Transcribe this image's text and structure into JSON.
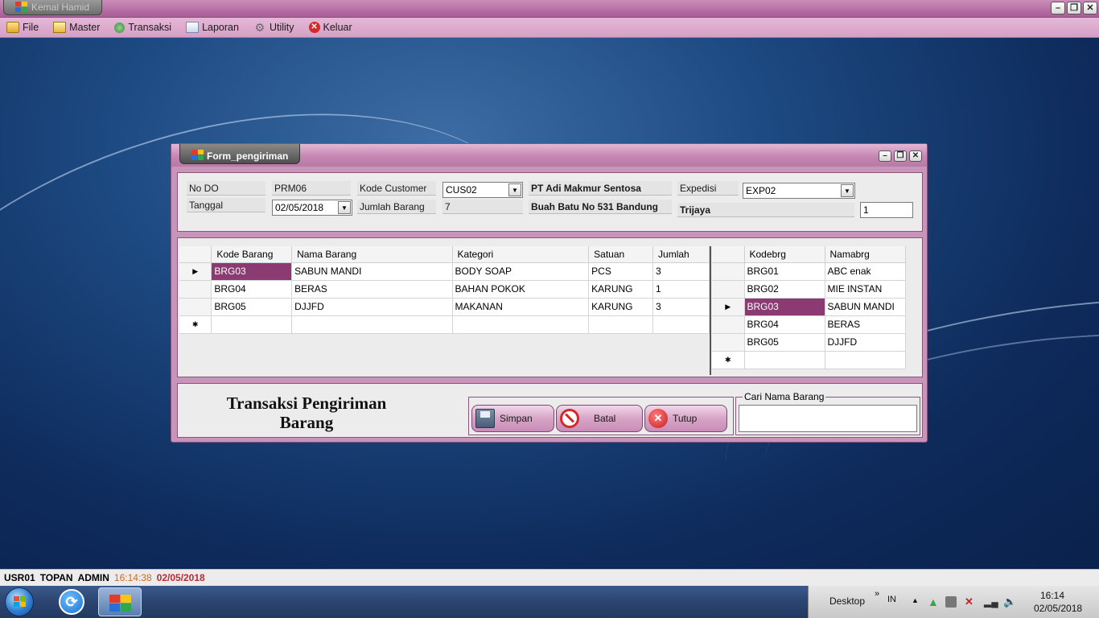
{
  "app": {
    "title": "Kemal Hamid"
  },
  "menu": [
    {
      "label": "File",
      "icon": "folder-icon"
    },
    {
      "label": "Master",
      "icon": "master-icon"
    },
    {
      "label": "Transaksi",
      "icon": "transaction-icon"
    },
    {
      "label": "Laporan",
      "icon": "report-icon"
    },
    {
      "label": "Utility",
      "icon": "gear-icon"
    },
    {
      "label": "Keluar",
      "icon": "exit-icon"
    }
  ],
  "form": {
    "title": "Form_pengiriman",
    "header": {
      "no_do_label": "No DO",
      "no_do_value": "PRM06",
      "tanggal_label": "Tanggal",
      "tanggal_value": "02/05/2018",
      "kode_customer_label": "Kode Customer",
      "kode_customer_value": "CUS02",
      "jumlah_barang_label": "Jumlah Barang",
      "jumlah_barang_value": "7",
      "customer_name": "PT Adi Makmur Sentosa",
      "customer_address": "Buah Batu No 531 Bandung",
      "expedisi_label": "Expedisi",
      "expedisi_value": "EXP02",
      "expedisi_name": "Trijaya",
      "qty_value": "1"
    },
    "detail_grid": {
      "columns": [
        "Kode Barang",
        "Nama Barang",
        "Kategori",
        "Satuan",
        "Jumlah"
      ],
      "rows": [
        [
          "BRG03",
          "SABUN MANDI",
          "BODY SOAP",
          "PCS",
          "3"
        ],
        [
          "BRG04",
          "BERAS",
          "BAHAN POKOK",
          "KARUNG",
          "1"
        ],
        [
          "BRG05",
          "DJJFD",
          "MAKANAN",
          "KARUNG",
          "3"
        ]
      ]
    },
    "barang_grid": {
      "columns": [
        "Kodebrg",
        "Namabrg"
      ],
      "rows": [
        [
          "BRG01",
          "ABC enak"
        ],
        [
          "BRG02",
          "MIE INSTAN"
        ],
        [
          "BRG03",
          "SABUN MANDI"
        ],
        [
          "BRG04",
          "BERAS"
        ],
        [
          "BRG05",
          "DJJFD"
        ]
      ]
    },
    "bottom": {
      "title_line1": "Transaksi Pengiriman",
      "title_line2": "Barang",
      "simpan_label": "Simpan",
      "batal_label": "Batal",
      "tutup_label": "Tutup",
      "search_legend": "Cari Nama Barang",
      "search_value": ""
    }
  },
  "status": {
    "user_id": "USR01",
    "user_name": "TOPAN",
    "role": "ADMIN",
    "time": "16:14:38",
    "date": "02/05/2018"
  },
  "taskbar": {
    "desktop_label": "Desktop",
    "lang": "IN",
    "clock_time": "16:14",
    "clock_date": "02/05/2018"
  },
  "colors": {
    "accent": "#c994b9",
    "selected_cell": "#8b3a72"
  }
}
